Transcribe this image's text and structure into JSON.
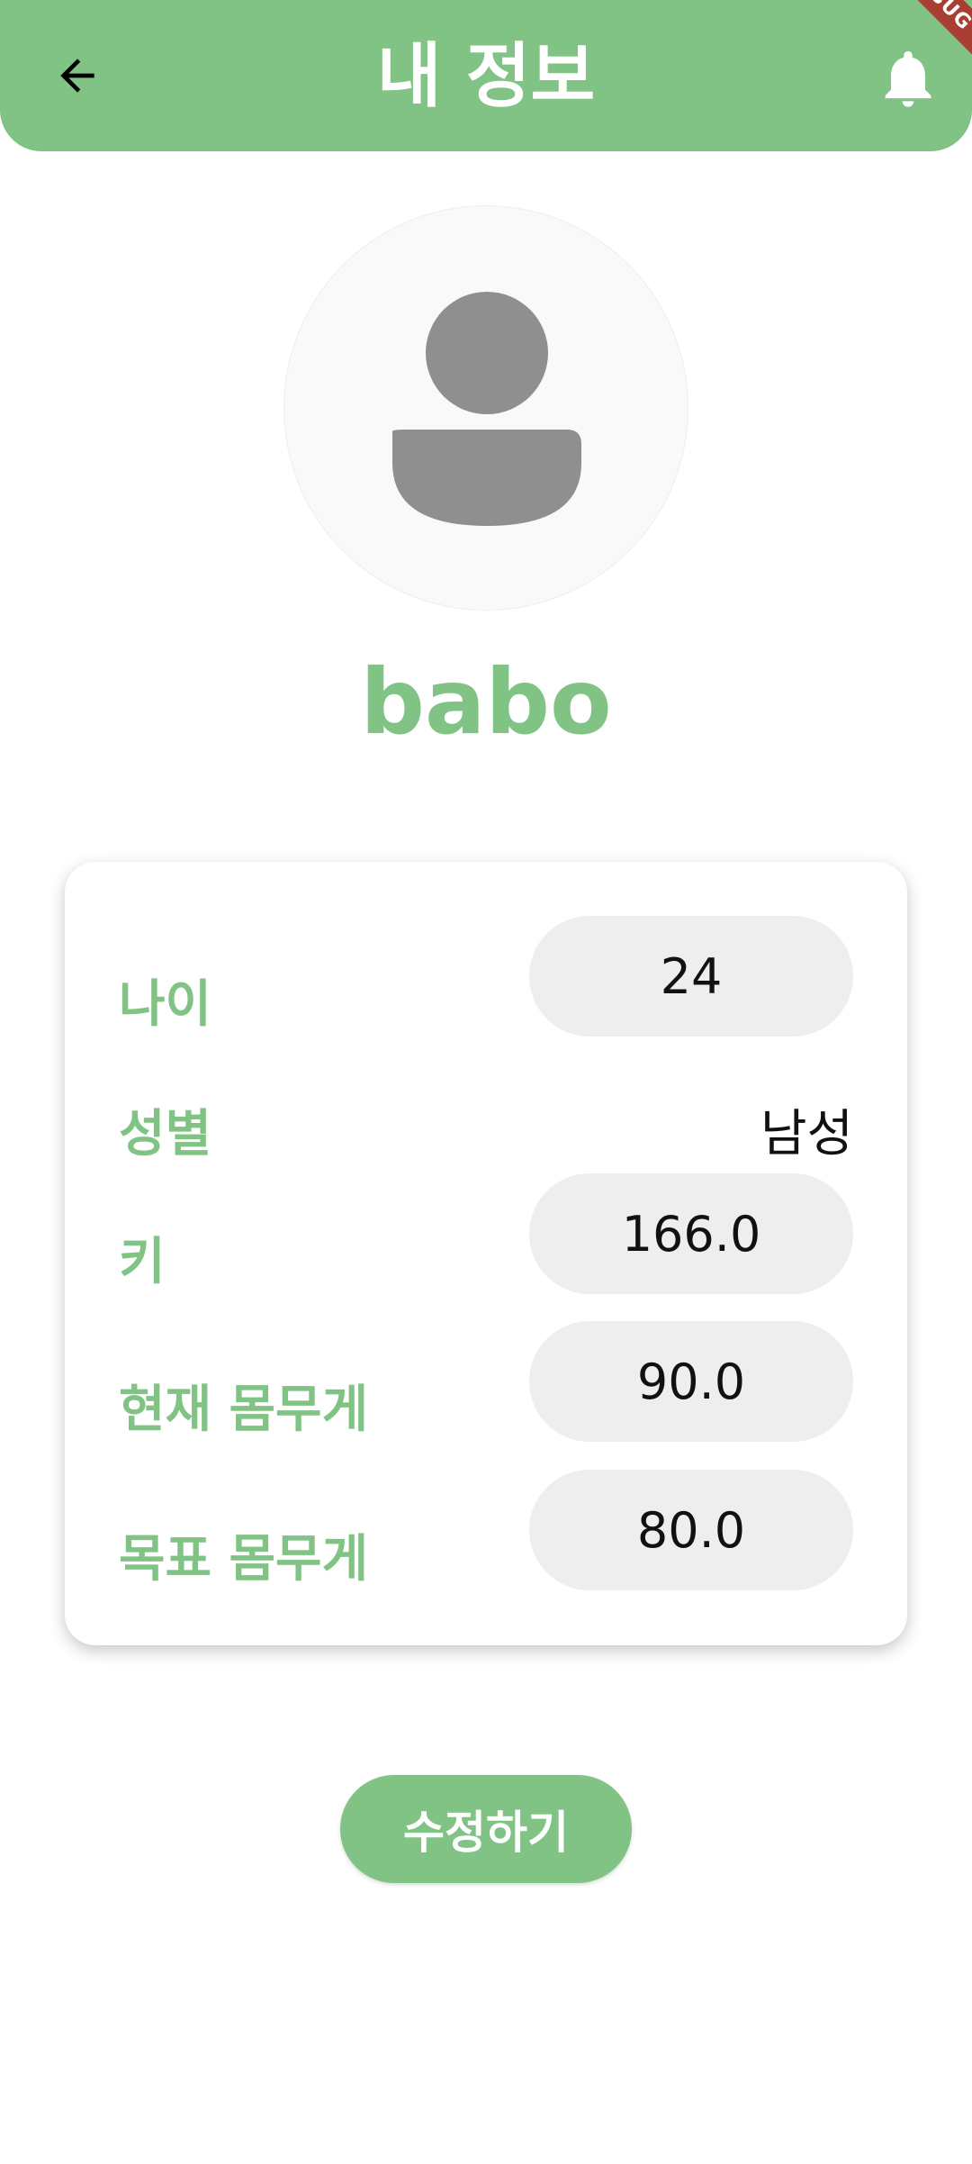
{
  "header": {
    "title": "내 정보",
    "debug_banner": "DEBUG",
    "back_icon": "arrow-left-icon",
    "bell_icon": "bell-icon"
  },
  "profile": {
    "avatar_icon": "person-icon",
    "username": "babo"
  },
  "info": {
    "age_label": "나이",
    "age_value": "24",
    "gender_label": "성별",
    "gender_value": "남성",
    "height_label": "키",
    "height_value": "166.0",
    "current_weight_label": "현재 몸무게",
    "current_weight_value": "90.0",
    "target_weight_label": "목표 몸무게",
    "target_weight_value": "80.0"
  },
  "actions": {
    "edit_label": "수정하기"
  },
  "colors": {
    "accent": "#81c384",
    "field_bg": "#eeeeee",
    "debug": "#a73f33"
  }
}
